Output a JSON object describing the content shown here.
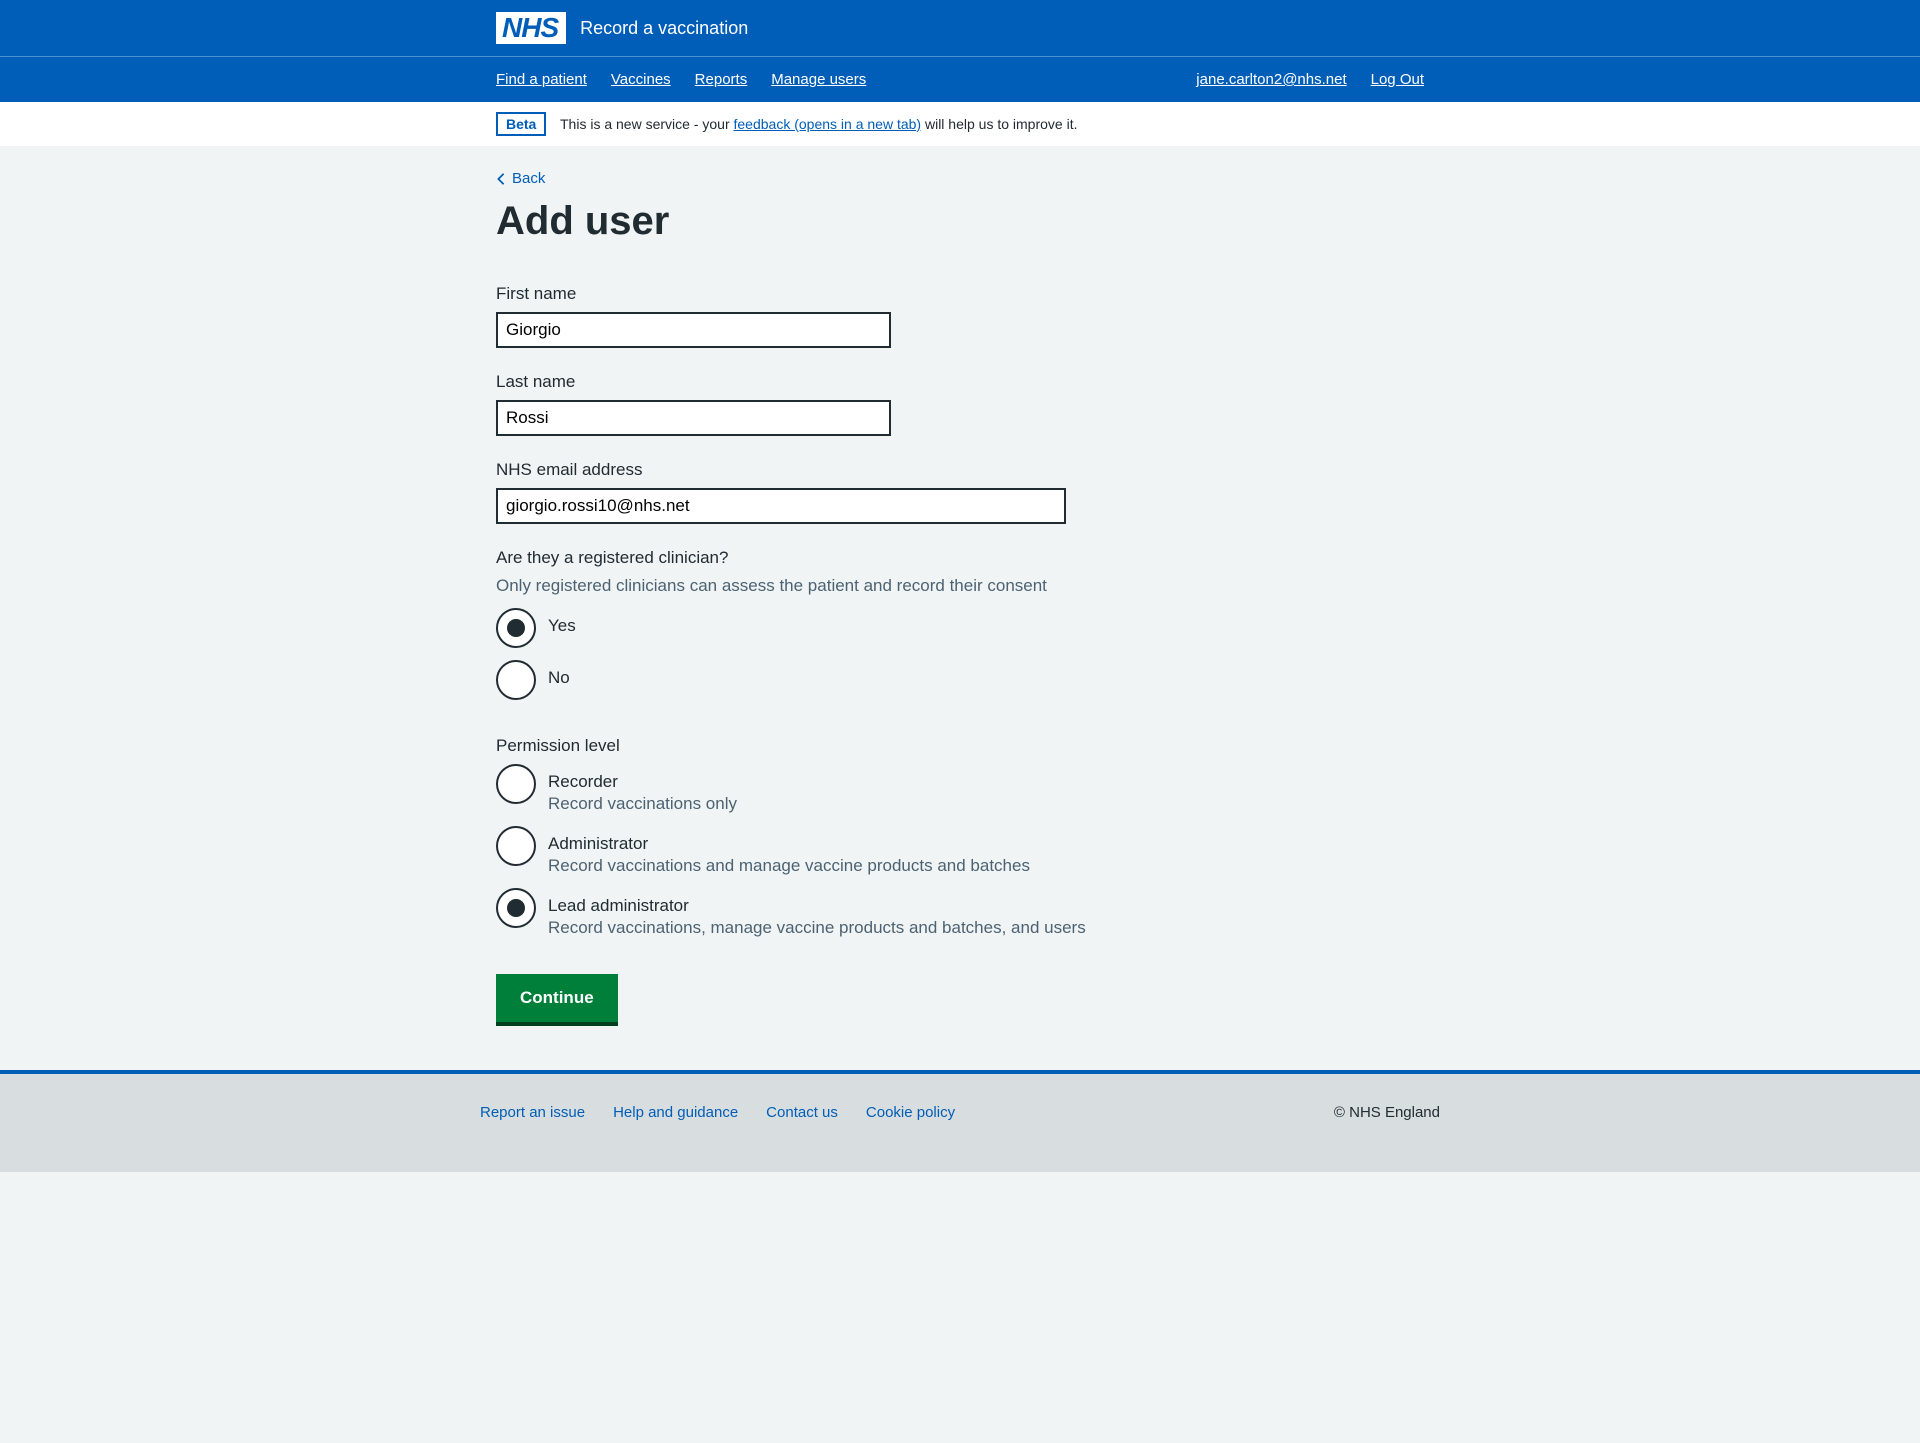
{
  "header": {
    "logo_text": "NHS",
    "service_name": "Record a vaccination",
    "nav": {
      "find_patient": "Find a patient",
      "vaccines": "Vaccines",
      "reports": "Reports",
      "manage_users": "Manage users"
    },
    "user_email": "jane.carlton2@nhs.net",
    "logout": "Log Out"
  },
  "phase": {
    "tag": "Beta",
    "text_before": "This is a new service - your ",
    "link_text": "feedback (opens in a new tab)",
    "text_after": " will help us to improve it."
  },
  "back_label": "Back",
  "page_title": "Add user",
  "form": {
    "first_name": {
      "label": "First name",
      "value": "Giorgio"
    },
    "last_name": {
      "label": "Last name",
      "value": "Rossi"
    },
    "email": {
      "label": "NHS email address",
      "value": "giorgio.rossi10@nhs.net"
    },
    "clinician": {
      "legend": "Are they a registered clinician?",
      "hint": "Only registered clinicians can assess the patient and record their consent",
      "yes": "Yes",
      "no": "No"
    },
    "permission": {
      "legend": "Permission level",
      "recorder": {
        "label": "Recorder",
        "hint": "Record vaccinations only"
      },
      "administrator": {
        "label": "Administrator",
        "hint": "Record vaccinations and manage vaccine products and batches"
      },
      "lead_administrator": {
        "label": "Lead administrator",
        "hint": "Record vaccinations, manage vaccine products and batches, and users"
      }
    },
    "continue": "Continue"
  },
  "footer": {
    "links": {
      "report": "Report an issue",
      "help": "Help and guidance",
      "contact": "Contact us",
      "cookie": "Cookie policy"
    },
    "copyright": "© NHS England"
  }
}
